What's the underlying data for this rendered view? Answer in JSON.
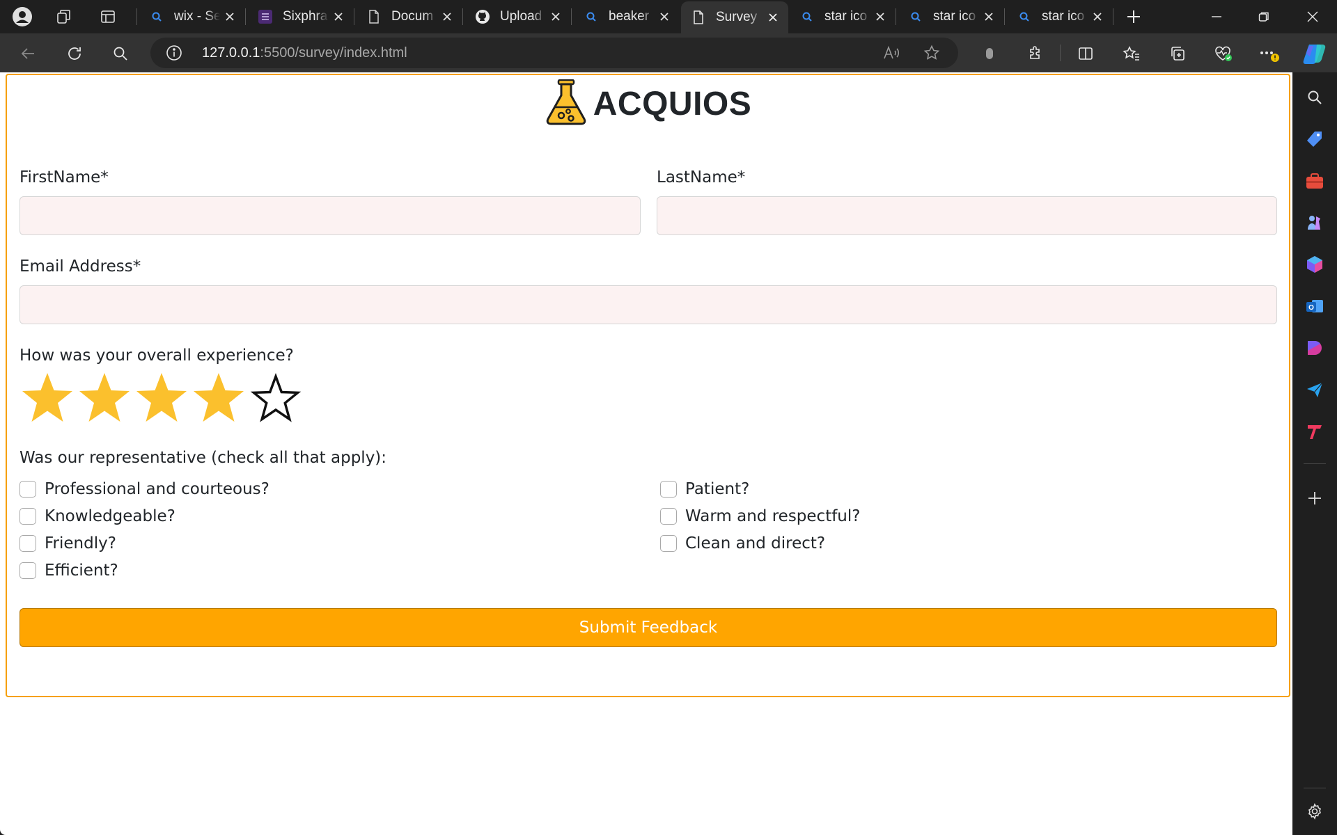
{
  "browser": {
    "tabs": [
      {
        "title": "wix - Se",
        "favicon": "search-icon",
        "active": false
      },
      {
        "title": "Sixphra",
        "favicon": "list-icon",
        "active": false
      },
      {
        "title": "Docum",
        "favicon": "document-icon",
        "active": false
      },
      {
        "title": "Upload",
        "favicon": "github-icon",
        "active": false
      },
      {
        "title": "beaker",
        "favicon": "search-icon",
        "active": false
      },
      {
        "title": "Survey",
        "favicon": "document-icon",
        "active": true
      },
      {
        "title": "star ico",
        "favicon": "search-icon",
        "active": false
      },
      {
        "title": "star ico",
        "favicon": "search-icon",
        "active": false
      },
      {
        "title": "star ico",
        "favicon": "search-icon",
        "active": false
      }
    ],
    "address": {
      "host": "127.0.0.1",
      "rest": ":5500/survey/index.html"
    },
    "accent_color": "#f6a000"
  },
  "survey": {
    "brand_title": "ACQUIOS",
    "first_name_label": "FirstName*",
    "last_name_label": "LastName*",
    "email_label": "Email Address*",
    "first_name_value": "",
    "last_name_value": "",
    "email_value": "",
    "experience_question": "How was your overall experience?",
    "rating": {
      "value": 4,
      "max": 5,
      "filled_color": "#fbc02d"
    },
    "representative_question": "Was our representative (check all that apply):",
    "checkboxes_left": [
      {
        "label": "Professional and courteous?",
        "checked": false
      },
      {
        "label": "Knowledgeable?",
        "checked": false
      },
      {
        "label": "Friendly?",
        "checked": false
      },
      {
        "label": "Efficient?",
        "checked": false
      }
    ],
    "checkboxes_right": [
      {
        "label": "Patient?",
        "checked": false
      },
      {
        "label": "Warm and respectful?",
        "checked": false
      },
      {
        "label": "Clean and direct?",
        "checked": false
      }
    ],
    "submit_label": "Submit Feedback",
    "submit_color": "#ffa500"
  }
}
